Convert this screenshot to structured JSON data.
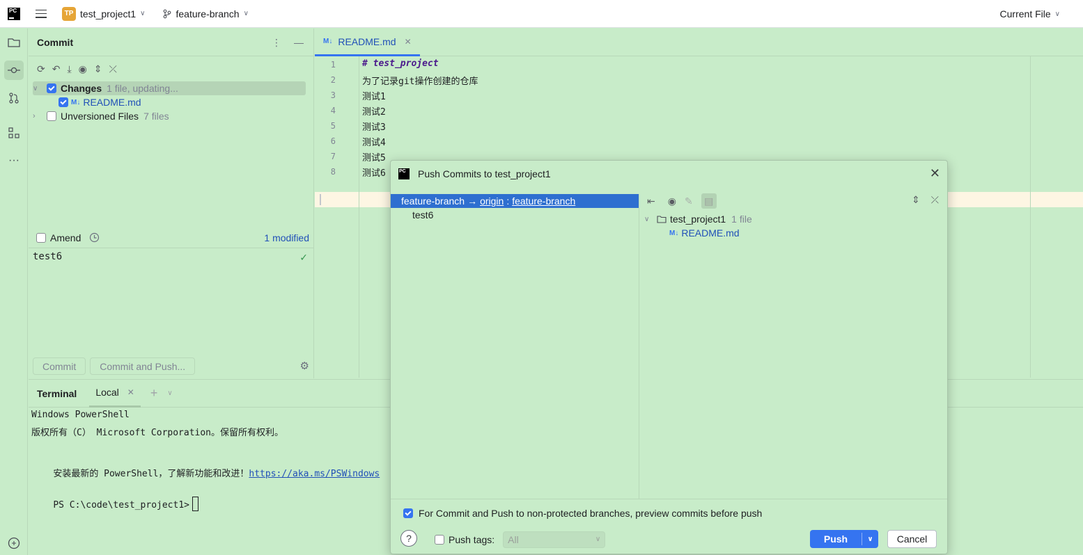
{
  "topbar": {
    "logo_text": "PC",
    "project_initials": "TP",
    "project_name": "test_project1",
    "branch": "feature-branch",
    "run_config": "Current File"
  },
  "commit_panel": {
    "title": "Commit",
    "changes_label": "Changes",
    "changes_status": "1 file, updating...",
    "changed_file": "README.md",
    "unversioned_label": "Unversioned Files",
    "unversioned_count": "7 files",
    "amend_label": "Amend",
    "modified_count": "1 modified",
    "commit_message": "test6",
    "commit_button": "Commit",
    "commit_push_button": "Commit and Push..."
  },
  "editor": {
    "tab_label": "README.md",
    "tab_icon": "M↓",
    "lines": [
      {
        "no": "1",
        "text": "# test_project"
      },
      {
        "no": "2",
        "text": "为了记录git操作创建的仓库"
      },
      {
        "no": "3",
        "text": "测试1"
      },
      {
        "no": "4",
        "text": "测试2"
      },
      {
        "no": "5",
        "text": "测试3"
      },
      {
        "no": "6",
        "text": "测试4"
      },
      {
        "no": "7",
        "text": "测试5"
      },
      {
        "no": "8",
        "text": "测试6"
      }
    ]
  },
  "terminal": {
    "title": "Terminal",
    "tab_label": "Local",
    "lines": [
      "Windows PowerShell",
      "版权所有（C） Microsoft Corporation。保留所有权利。",
      "",
      "安装最新的 PowerShell，了解新功能和改进！",
      "",
      "PS C:\\code\\test_project1>"
    ],
    "link_text": "https://aka.ms/PSWindows"
  },
  "dialog": {
    "title": "Push Commits to test_project1",
    "push_source": "feature-branch",
    "push_arrow": "→",
    "remote": "origin",
    "separator": ":",
    "target_branch": "feature-branch",
    "commit_entry": "test6",
    "repo_name": "test_project1",
    "repo_files": "1 file",
    "file_name": "README.md",
    "preview_option": "For Commit and Push to non-protected branches, preview commits before push",
    "push_tags_label": "Push tags:",
    "push_tags_value": "All",
    "push_button": "Push",
    "cancel_button": "Cancel",
    "help_symbol": "?"
  },
  "colors": {
    "background": "#c8ecc9",
    "accent": "#3574f0",
    "selection": "#2e6fd0",
    "link": "#2150b8"
  }
}
